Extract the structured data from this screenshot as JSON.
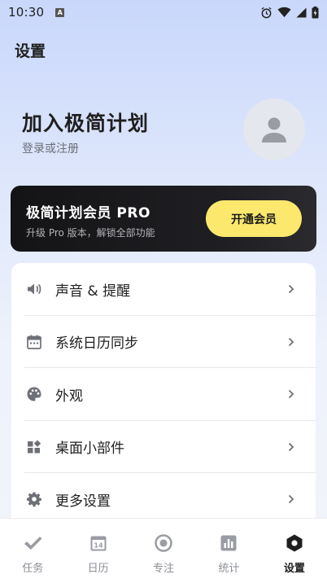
{
  "status_bar": {
    "time": "10:30",
    "badge": "A"
  },
  "header": {
    "title": "设置"
  },
  "profile": {
    "name": "加入极简计划",
    "subtitle": "登录或注册"
  },
  "vip": {
    "title": "极简计划会员 PRO",
    "subtitle": "升级 Pro 版本，解锁全部功能",
    "button_label": "开通会员"
  },
  "settings": {
    "items": [
      {
        "label": "声音 & 提醒",
        "icon": "volume-icon"
      },
      {
        "label": "系统日历同步",
        "icon": "calendar-icon"
      },
      {
        "label": "外观",
        "icon": "palette-icon"
      },
      {
        "label": "桌面小部件",
        "icon": "widget-icon"
      },
      {
        "label": "更多设置",
        "icon": "gear-icon"
      }
    ]
  },
  "tabs": [
    {
      "label": "任务",
      "icon": "check-icon"
    },
    {
      "label": "日历",
      "icon": "calendar-icon",
      "badge": "14"
    },
    {
      "label": "专注",
      "icon": "focus-icon"
    },
    {
      "label": "统计",
      "icon": "stats-icon"
    },
    {
      "label": "设置",
      "icon": "hexagon-settings-icon",
      "active": true
    }
  ],
  "colors": {
    "accent_yellow": "#fbe86d",
    "card_dark": "#1a1a1d",
    "muted": "#8a8d94"
  }
}
